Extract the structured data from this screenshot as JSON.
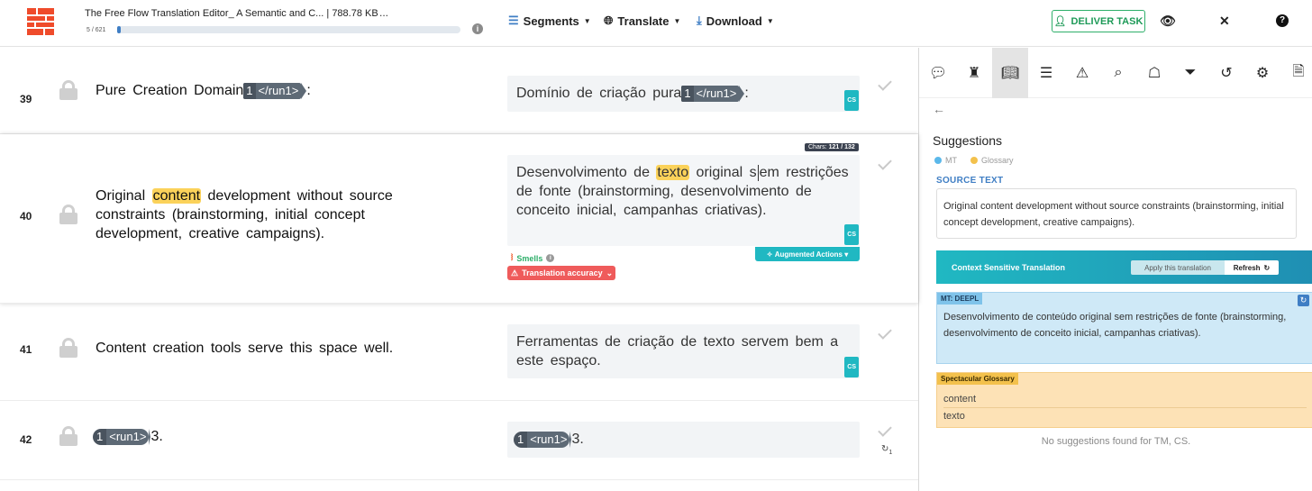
{
  "header": {
    "filename": "The Free Flow Translation Editor_ A Semantic and C... | 788.78 KB",
    "more": "...",
    "progress_text": "5 / 621",
    "progress_fraction": 0.008,
    "menus": [
      {
        "label": "Segments",
        "icon": "list-icon"
      },
      {
        "label": "Translate",
        "icon": "globe-icon"
      },
      {
        "label": "Download",
        "icon": "download-icon"
      }
    ],
    "deliver_label": "DELIVER TASK"
  },
  "segments": [
    {
      "num": "39",
      "source_pre": "Pure  Creation  Domain",
      "source_tag_num": "1",
      "source_tag": "</run1>",
      "source_post": ":",
      "target_pre": "Domínio  de  criação  pura",
      "target_tag_num": "1",
      "target_tag": "</run1>",
      "target_post": ":",
      "badge": "CS"
    },
    {
      "num": "40",
      "source_pre": "Original",
      "source_hl": "content",
      "source_post": " development  without  source  constraints  (brainstorming,  initial  concept  development,  creative  campaigns).",
      "target_pre": "Desenvolvimento  de",
      "target_hl": "texto",
      "target_mid": " original  s",
      "target_post": "em restrições  de  fonte  (brainstorming,  desenvolvimento  de  conceito  inicial,  campanhas  criativas).",
      "badge": "CS",
      "chars_label": "Chars:",
      "chars_value": "121 / 132",
      "augmented": "Augmented Actions",
      "smells": "Smells",
      "accuracy": "Translation accuracy"
    },
    {
      "num": "41",
      "source": "Content  creation  tools  serve  this  space  well.",
      "target": "Ferramentas  de  criação  de  texto  servem  bem  a  este  espaço.",
      "badge": "CS"
    },
    {
      "num": "42",
      "source_tag_num": "1",
      "source_tag": "<run1>",
      "source_post": "3.",
      "target_tag_num": "1",
      "target_tag": "<run1>",
      "target_post": "3.",
      "history_count": "1"
    }
  ],
  "sidebar": {
    "tabs": [
      "comments-icon",
      "chef-hat-icon",
      "book-icon",
      "list-icon",
      "warning-icon",
      "search-icon",
      "reader-icon",
      "filter-icon",
      "history-icon",
      "settings-icon",
      "pdf-icon"
    ],
    "active_tab": 2,
    "title": "Suggestions",
    "legend": [
      {
        "label": "MT",
        "color": "#5bb8ea"
      },
      {
        "label": "Glossary",
        "color": "#f3c14c"
      }
    ],
    "source_label": "SOURCE TEXT",
    "source_text": "Original content development without source constraints (brainstorming, initial concept development, creative campaigns).",
    "cst_title": "Context Sensitive Translation",
    "cst_apply": "Apply this translation",
    "cst_refresh": "Refresh",
    "mt_label": "MT: DEEPL",
    "mt_text": "Desenvolvimento de conteúdo original sem restrições de fonte (brainstorming, desenvolvimento de conceito inicial, campanhas criativas).",
    "glossary_label": "Spectacular Glossary",
    "glossary_terms": [
      "content",
      "texto"
    ],
    "no_suggestions": "No suggestions found for TM, CS."
  }
}
